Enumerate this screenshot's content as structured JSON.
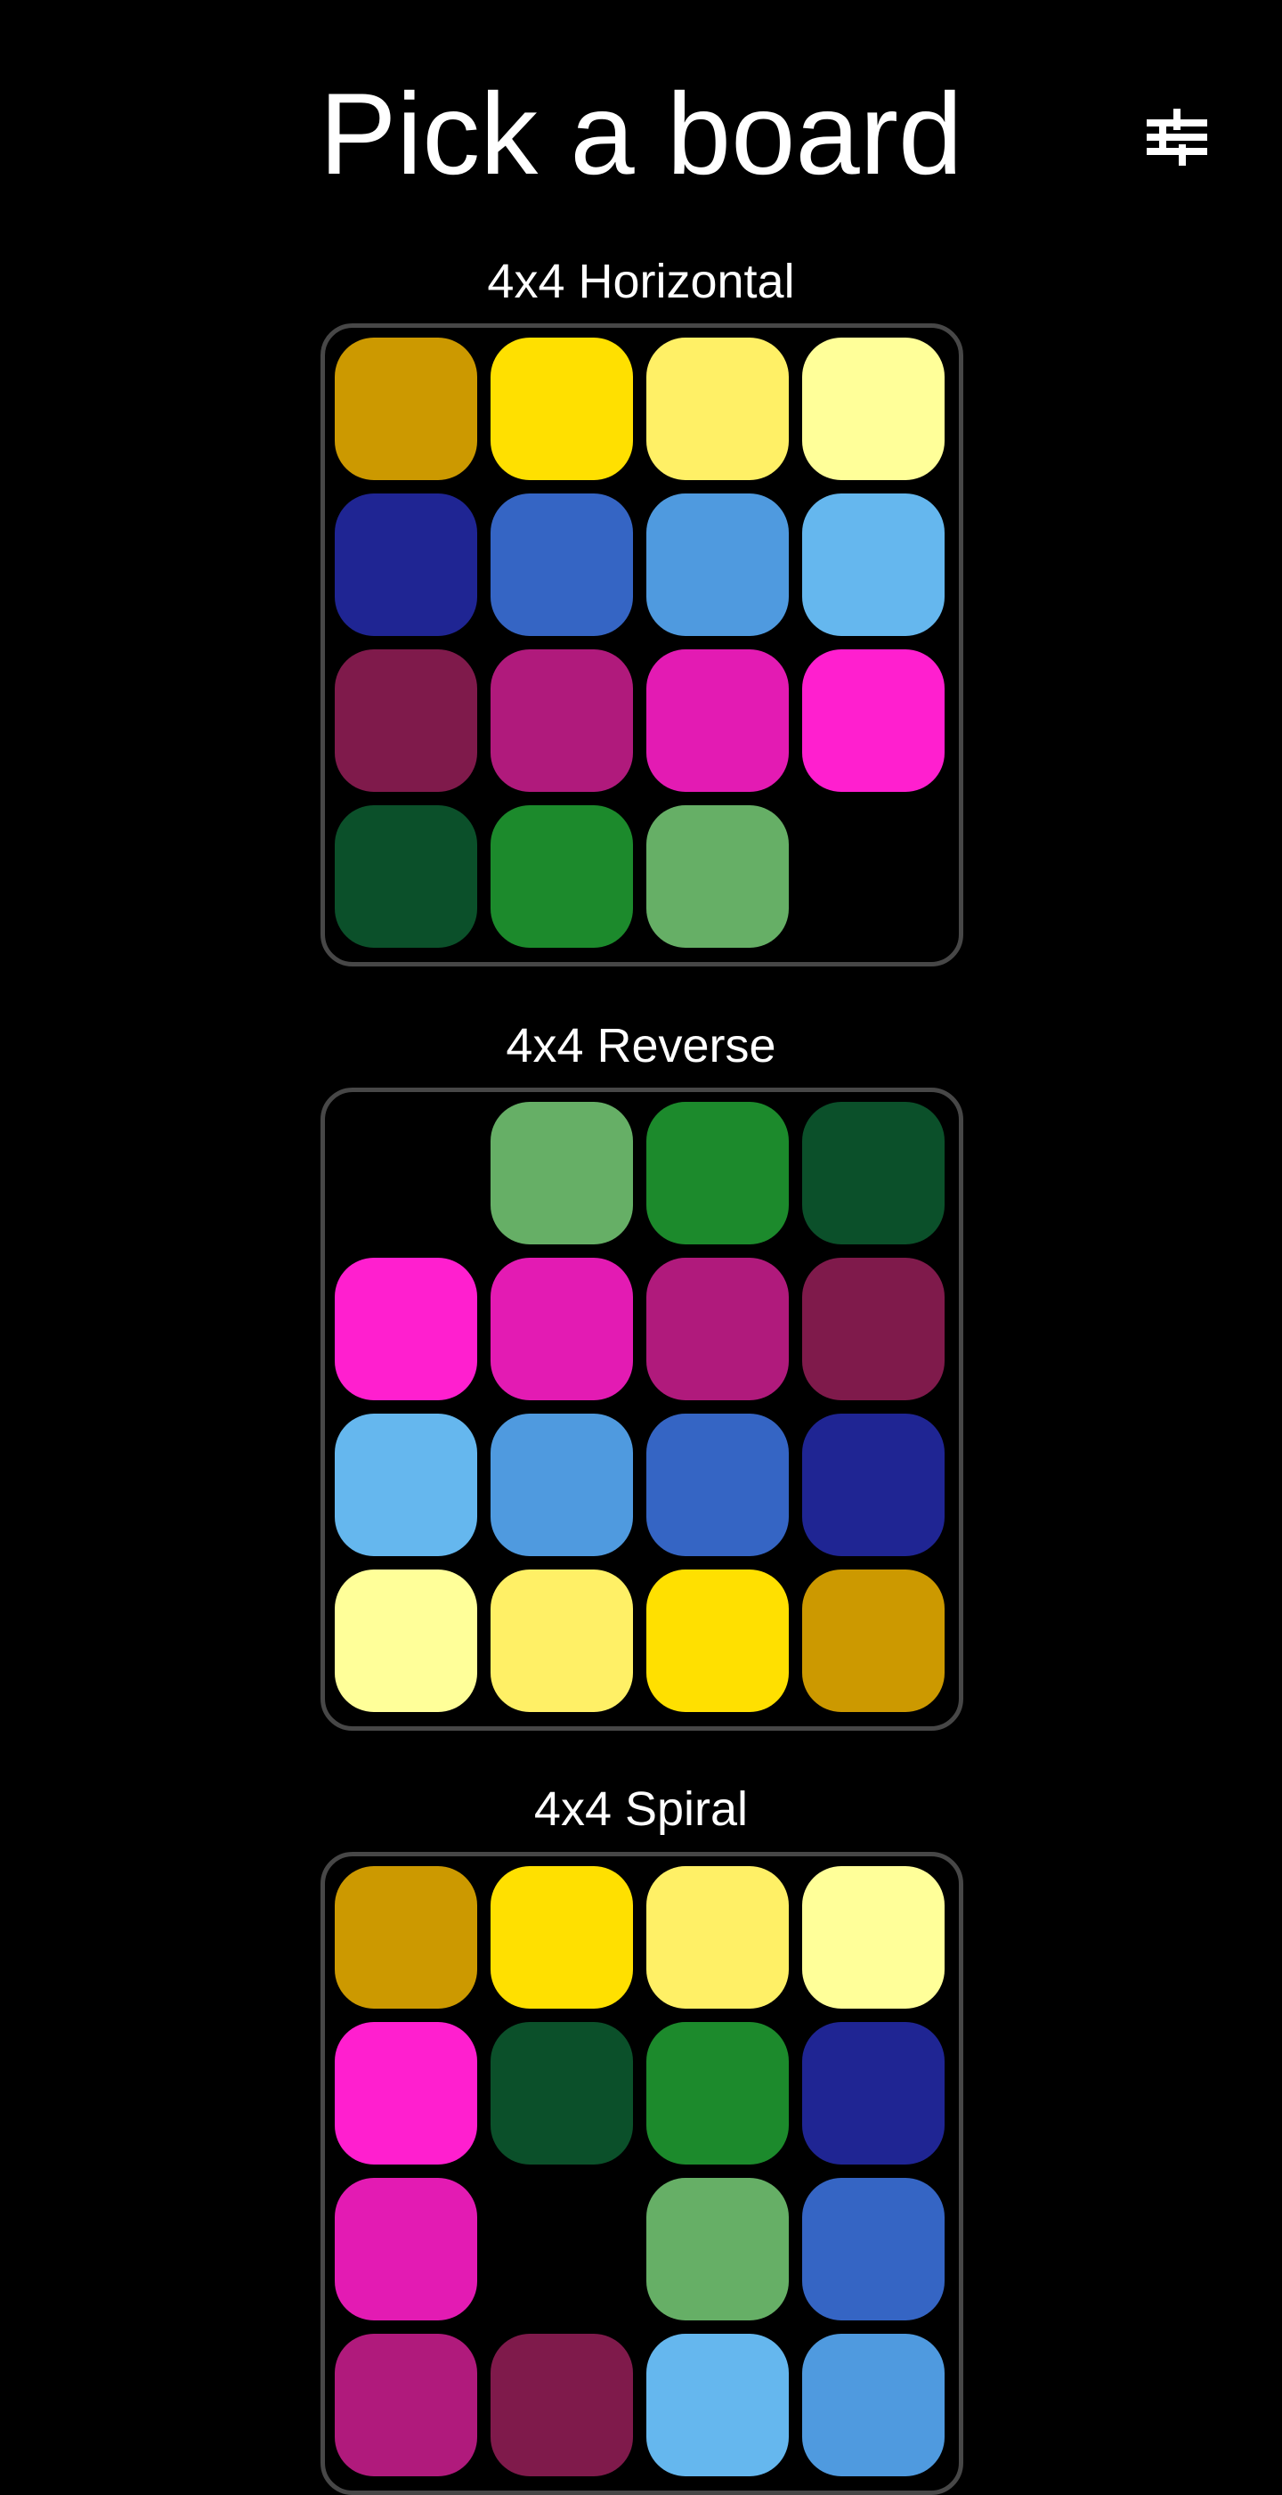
{
  "header": {
    "title": "Pick a board",
    "settings_icon": "tune-sliders-icon"
  },
  "colors": {
    "background": "#000000",
    "board_border": "#474747",
    "text": "#ffffff"
  },
  "palette": {
    "Y1": "#CC9900",
    "Y2": "#FFE000",
    "Y3": "#FFF066",
    "Y4": "#FFFF99",
    "B1": "#1F2593",
    "B2": "#3565C4",
    "B3": "#4F9ADF",
    "B4": "#65B7EE",
    "M1": "#7F1A4B",
    "M2": "#B01A7C",
    "M3": "#E31BB3",
    "M4": "#FF1FCF",
    "G1": "#0B502A",
    "G2": "#1C8A2C",
    "G3": "#66AF66"
  },
  "boards": [
    {
      "title": "4x4 Horizontal",
      "tiles": [
        [
          "Y1",
          "Y2",
          "Y3",
          "Y4"
        ],
        [
          "B1",
          "B2",
          "B3",
          "B4"
        ],
        [
          "M1",
          "M2",
          "M3",
          "M4"
        ],
        [
          "G1",
          "G2",
          "G3",
          null
        ]
      ]
    },
    {
      "title": "4x4 Reverse",
      "tiles": [
        [
          null,
          "G3",
          "G2",
          "G1"
        ],
        [
          "M4",
          "M3",
          "M2",
          "M1"
        ],
        [
          "B4",
          "B3",
          "B2",
          "B1"
        ],
        [
          "Y4",
          "Y3",
          "Y2",
          "Y1"
        ]
      ]
    },
    {
      "title": "4x4 Spiral",
      "tiles": [
        [
          "Y1",
          "Y2",
          "Y3",
          "Y4"
        ],
        [
          "M4",
          "G1",
          "G2",
          "B1"
        ],
        [
          "M3",
          null,
          "G3",
          "B2"
        ],
        [
          "M2",
          "M1",
          "B4",
          "B3"
        ]
      ]
    }
  ]
}
